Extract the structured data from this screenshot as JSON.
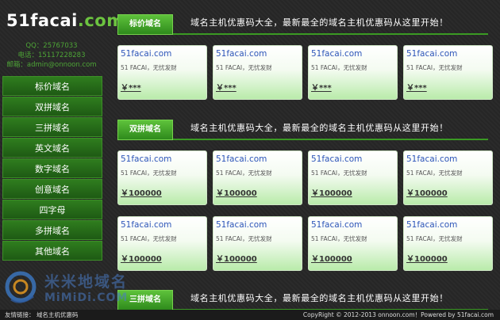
{
  "logo": {
    "white": "51facai",
    "green": ".com"
  },
  "contact": {
    "qq": "QQ：25767033",
    "phone": "电话：15117228283",
    "email": "邮箱：admin@onnoon.com"
  },
  "sidebar": {
    "items": [
      {
        "label": "标价域名"
      },
      {
        "label": "双拼域名"
      },
      {
        "label": "三拼域名"
      },
      {
        "label": "英文域名"
      },
      {
        "label": "数字域名"
      },
      {
        "label": "创意域名"
      },
      {
        "label": "四字母"
      },
      {
        "label": "多拼域名"
      },
      {
        "label": "其他域名"
      }
    ]
  },
  "sections": [
    {
      "tab": "标价域名",
      "slogan": "域名主机优惠码大全，最新最全的域名主机优惠码从这里开始！",
      "cards": [
        {
          "domain": "51facai.com",
          "desc": "51 FACAI，无忧发财",
          "price": "￥***"
        },
        {
          "domain": "51facai.com",
          "desc": "51 FACAI，无忧发财",
          "price": "￥***"
        },
        {
          "domain": "51facai.com",
          "desc": "51 FACAI，无忧发财",
          "price": "￥***"
        },
        {
          "domain": "51facai.com",
          "desc": "51 FACAI，无忧发财",
          "price": "￥***"
        }
      ]
    },
    {
      "tab": "双拼域名",
      "slogan": "域名主机优惠码大全，最新最全的域名主机优惠码从这里开始！",
      "cards": [
        {
          "domain": "51facai.com",
          "desc": "51 FACAI，无忧发财",
          "price": "￥100000"
        },
        {
          "domain": "51facai.com",
          "desc": "51 FACAI，无忧发财",
          "price": "￥100000"
        },
        {
          "domain": "51facai.com",
          "desc": "51 FACAI，无忧发财",
          "price": "￥100000"
        },
        {
          "domain": "51facai.com",
          "desc": "51 FACAI，无忧发财",
          "price": "￥100000"
        },
        {
          "domain": "51facai.com",
          "desc": "51 FACAI，无忧发财",
          "price": "￥100000"
        },
        {
          "domain": "51facai.com",
          "desc": "51 FACAI，无忧发财",
          "price": "￥100000"
        },
        {
          "domain": "51facai.com",
          "desc": "51 FACAI，无忧发财",
          "price": "￥100000"
        },
        {
          "domain": "51facai.com",
          "desc": "51 FACAI，无忧发财",
          "price": "￥100000"
        }
      ]
    },
    {
      "tab": "三拼域名",
      "slogan": "域名主机优惠码大全，最新最全的域名主机优惠码从这里开始！",
      "cards": []
    }
  ],
  "watermark": {
    "cn": "米米地域名",
    "en": "MiMiDi.COM"
  },
  "footer": {
    "links_label": "友情链接：",
    "link": "域名主机优惠码",
    "copyright": "CopyRight © 2012-2013 onnoon.com！Powered by 51facai.com"
  }
}
